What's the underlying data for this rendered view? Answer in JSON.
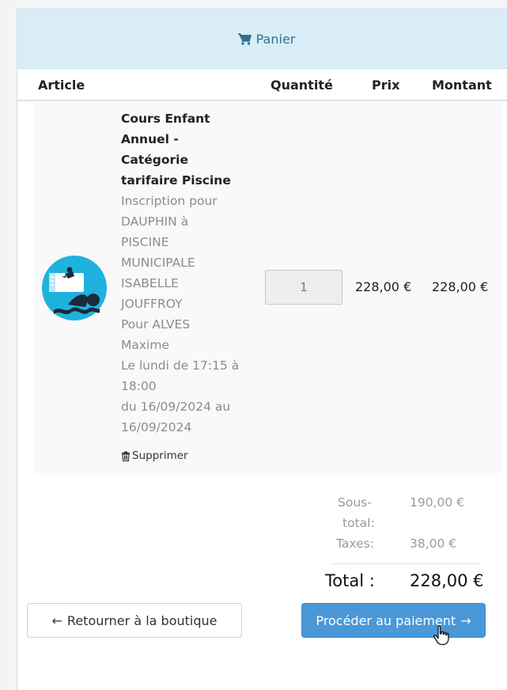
{
  "header": {
    "title": "Panier",
    "icon": "cart-icon",
    "color": "#31708f",
    "background": "#d9edf7"
  },
  "table": {
    "columns": [
      "Article",
      "Quantité",
      "Prix",
      "Montant"
    ]
  },
  "item": {
    "name_lines": [
      "Cours Enfant",
      "Annuel -",
      "Catégorie",
      "tarifaire Piscine"
    ],
    "detail_lines": [
      "Inscription pour",
      "DAUPHIN à",
      "PISCINE",
      "MUNICIPALE",
      "ISABELLE",
      "JOUFFROY",
      "Pour ALVES",
      "Maxime",
      "Le lundi de 17:15 à",
      "18:00",
      "du 16/09/2024 au",
      "16/09/2024"
    ],
    "image_icon": "swimmer-icon",
    "delete_label": "Supprimer",
    "quantity": "1",
    "price": "228,00 €",
    "amount": "228,00 €"
  },
  "totals": {
    "subtotal_label_1": "Sous-",
    "subtotal_label_2": "total:",
    "subtotal_value": "190,00 €",
    "tax_label": "Taxes:",
    "tax_value": "38,00 €",
    "total_label": "Total :",
    "total_value": "228,00 €"
  },
  "buttons": {
    "back": "Retourner à la boutique",
    "pay": "Procéder au paiement",
    "pay_color": "#4a98d8"
  }
}
